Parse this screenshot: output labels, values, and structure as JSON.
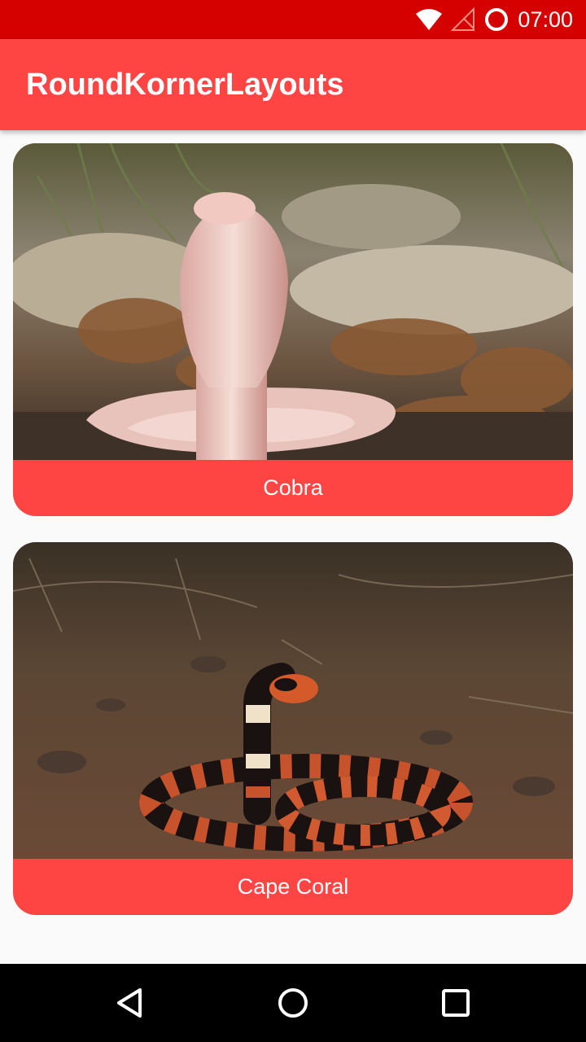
{
  "status_bar": {
    "time": "07:00",
    "icons": [
      "wifi-icon",
      "no-signal-icon",
      "alarm-icon"
    ]
  },
  "app_bar": {
    "title": "RoundKornerLayouts"
  },
  "cards": [
    {
      "caption": "Cobra",
      "image": "albino cobra photo"
    },
    {
      "caption": "Cape Coral",
      "image": "cape coral snake photo"
    }
  ],
  "nav_bar": {
    "buttons": [
      "back-icon",
      "home-icon",
      "recents-icon"
    ]
  },
  "colors": {
    "status_bar": "#d50000",
    "primary": "#ff4444",
    "background": "#fafafa"
  }
}
